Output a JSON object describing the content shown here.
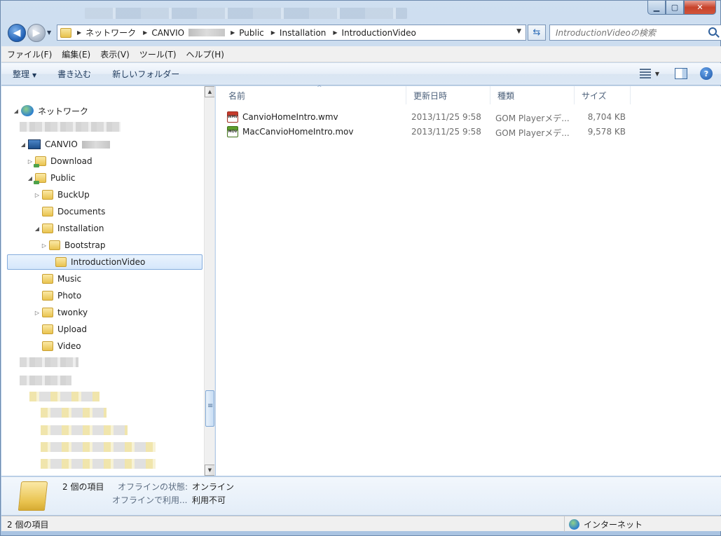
{
  "address": {
    "crumbs": [
      "ネットワーク",
      "CANVIO",
      "Public",
      "Installation",
      "IntroductionVideo"
    ],
    "search_placeholder": "IntroductionVideoの検索"
  },
  "menu": [
    "ファイル(F)",
    "編集(E)",
    "表示(V)",
    "ツール(T)",
    "ヘルプ(H)"
  ],
  "toolbar": {
    "organize": "整理",
    "burn": "書き込む",
    "new_folder": "新しいフォルダー"
  },
  "tree": {
    "network": "ネットワーク",
    "canvio": "CANVIO",
    "download": "Download",
    "public": "Public",
    "buckup": "BuckUp",
    "documents": "Documents",
    "installation": "Installation",
    "bootstrap": "Bootstrap",
    "introductionvideo": "IntroductionVideo",
    "music": "Music",
    "photo": "Photo",
    "twonky": "twonky",
    "upload": "Upload",
    "video": "Video"
  },
  "columns": {
    "name": "名前",
    "date": "更新日時",
    "type": "種類",
    "size": "サイズ"
  },
  "files": [
    {
      "name": "CanvioHomeIntro.wmv",
      "icon": "wmv",
      "date": "2013/11/25 9:58",
      "type": "GOM Playerメデ...",
      "size": "8,704 KB"
    },
    {
      "name": "MacCanvioHomeIntro.mov",
      "icon": "mov",
      "date": "2013/11/25 9:58",
      "type": "GOM Playerメデ...",
      "size": "9,578 KB"
    }
  ],
  "details": {
    "count": "2 個の項目",
    "offline_label": "オフラインの状態:",
    "offline_value": "オンライン",
    "offline_use_label": "オフラインで利用...",
    "offline_use_value": "利用不可"
  },
  "status": {
    "count": "2 個の項目",
    "zone": "インターネット"
  }
}
